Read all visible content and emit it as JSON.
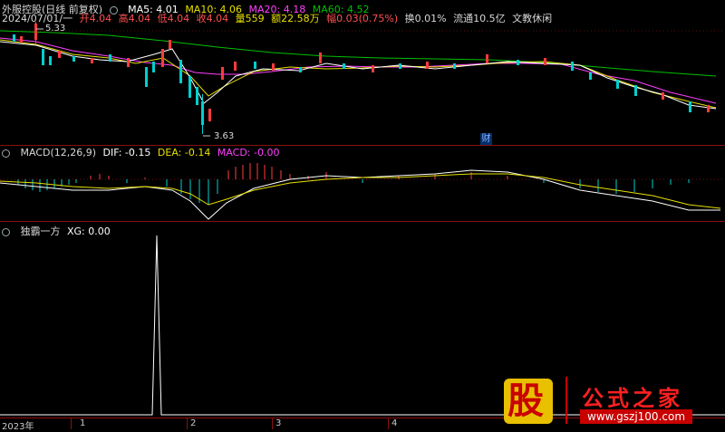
{
  "header": {
    "stock_name": "外服控股(日线 前复权)",
    "ma5": "MA5: 4.01",
    "ma10": "MA10: 4.06",
    "ma20": "MA20: 4.18",
    "ma60": "MA60: 4.52",
    "date": "2024/07/01/一",
    "open": "开4.04",
    "high": "高4.04",
    "low": "低4.04",
    "close": "收4.04",
    "vol": "量559",
    "amount": "额22.58万",
    "change": "幅0.03(0.75%)",
    "turnover": "换0.01%",
    "float_cap": "流通10.5亿",
    "industry": "文教休闲"
  },
  "price_annotations": {
    "high_label": "5.33",
    "low_label": "3.63",
    "cai_label": "财"
  },
  "macd_header": {
    "title": "MACD(12,26,9)",
    "dif": "DIF: -0.15",
    "dea": "DEA: -0.14",
    "macd": "MACD: -0.00"
  },
  "indicator_header": {
    "title": "独霸一方",
    "xg": "XG: 0.00"
  },
  "bottom_axis": [
    "2023年",
    "1",
    "2",
    "3",
    "4"
  ],
  "watermark": {
    "glyph": "股",
    "brand": "公式之家",
    "url": "www.gszj100.com"
  },
  "colors": {
    "up": "#ff3b3b",
    "down": "#00d0d0",
    "ma5": "#ffffff",
    "ma10": "#e8e000",
    "ma20": "#ff40ff",
    "ma60": "#00c000",
    "grid": "#8a1010"
  }
}
